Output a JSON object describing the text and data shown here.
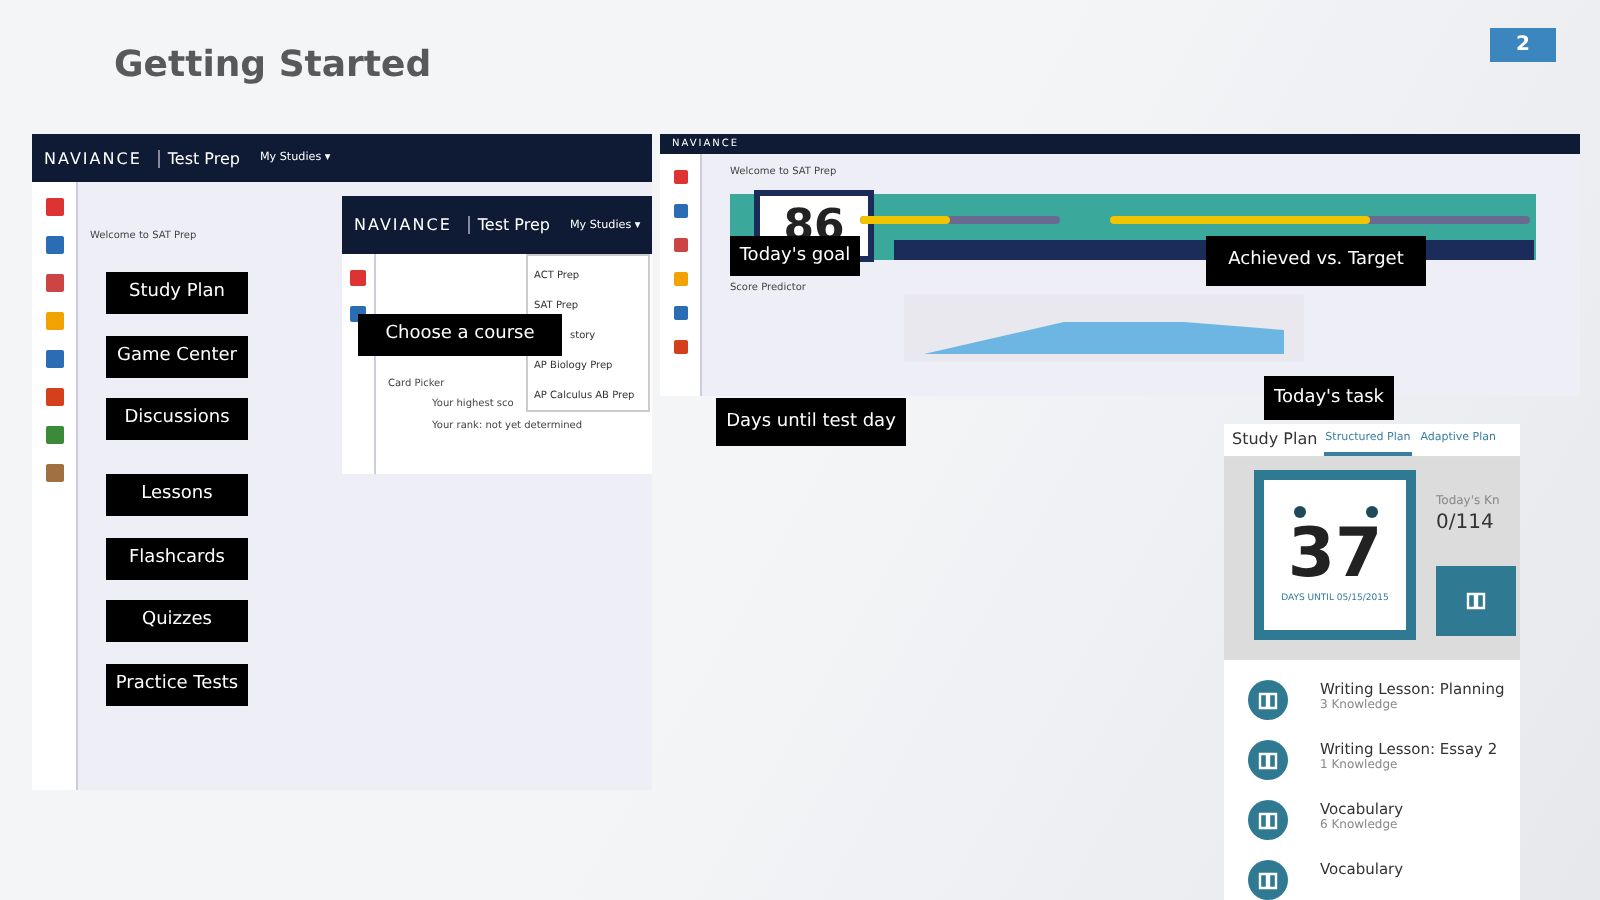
{
  "slide": {
    "title": "Getting Started",
    "page_number": "2"
  },
  "left_screenshot": {
    "brand": "NAVIANCE",
    "product": "Test Prep",
    "menu": "My Studies ▾",
    "welcome": "Welcome to SAT Prep",
    "overlay": {
      "brand": "NAVIANCE",
      "product": "Test Prep",
      "menu": "My Studies ▾",
      "dropdown": [
        "ACT Prep",
        "SAT Prep",
        "story",
        "AP Biology Prep",
        "AP Calculus AB Prep"
      ],
      "card_title": "Card Picker",
      "card_lines": [
        "Your highest sco",
        "Your rank: not yet determined"
      ]
    }
  },
  "left_callouts": [
    "Study Plan",
    "Game Center",
    "Discussions",
    "Lessons",
    "Flashcards",
    "Quizzes",
    "Practice Tests"
  ],
  "overlay_callout": "Choose a course",
  "dashboard_screenshot": {
    "brand": "NAVIANCE",
    "welcome": "Welcome to SAT Prep",
    "days": "86",
    "bars": [
      {
        "level": 0.45
      },
      {
        "level": 0.62
      }
    ],
    "score_heading": "Score Predictor"
  },
  "dashboard_callouts": [
    {
      "label": "Today's goal"
    },
    {
      "label": "Achieved vs. Target"
    },
    {
      "label": "Today's task"
    },
    {
      "label": "Days until test day"
    }
  ],
  "study_plan": {
    "title": "Study Plan",
    "tabs": [
      {
        "label": "Structured Plan",
        "selected": true
      },
      {
        "label": "Adaptive Plan",
        "selected": false
      }
    ],
    "days": "37",
    "days_caption": "DAYS UNTIL 05/15/2015",
    "goal_label": "Today's Kn",
    "goal_value": "0/114",
    "lessons": [
      {
        "title": "Writing Lesson: Planning",
        "meta": "3 Knowledge"
      },
      {
        "title": "Writing Lesson: Essay 2",
        "meta": "1 Knowledge"
      },
      {
        "title": "Vocabulary",
        "meta": "6 Knowledge"
      },
      {
        "title": "Vocabulary"
      }
    ]
  }
}
